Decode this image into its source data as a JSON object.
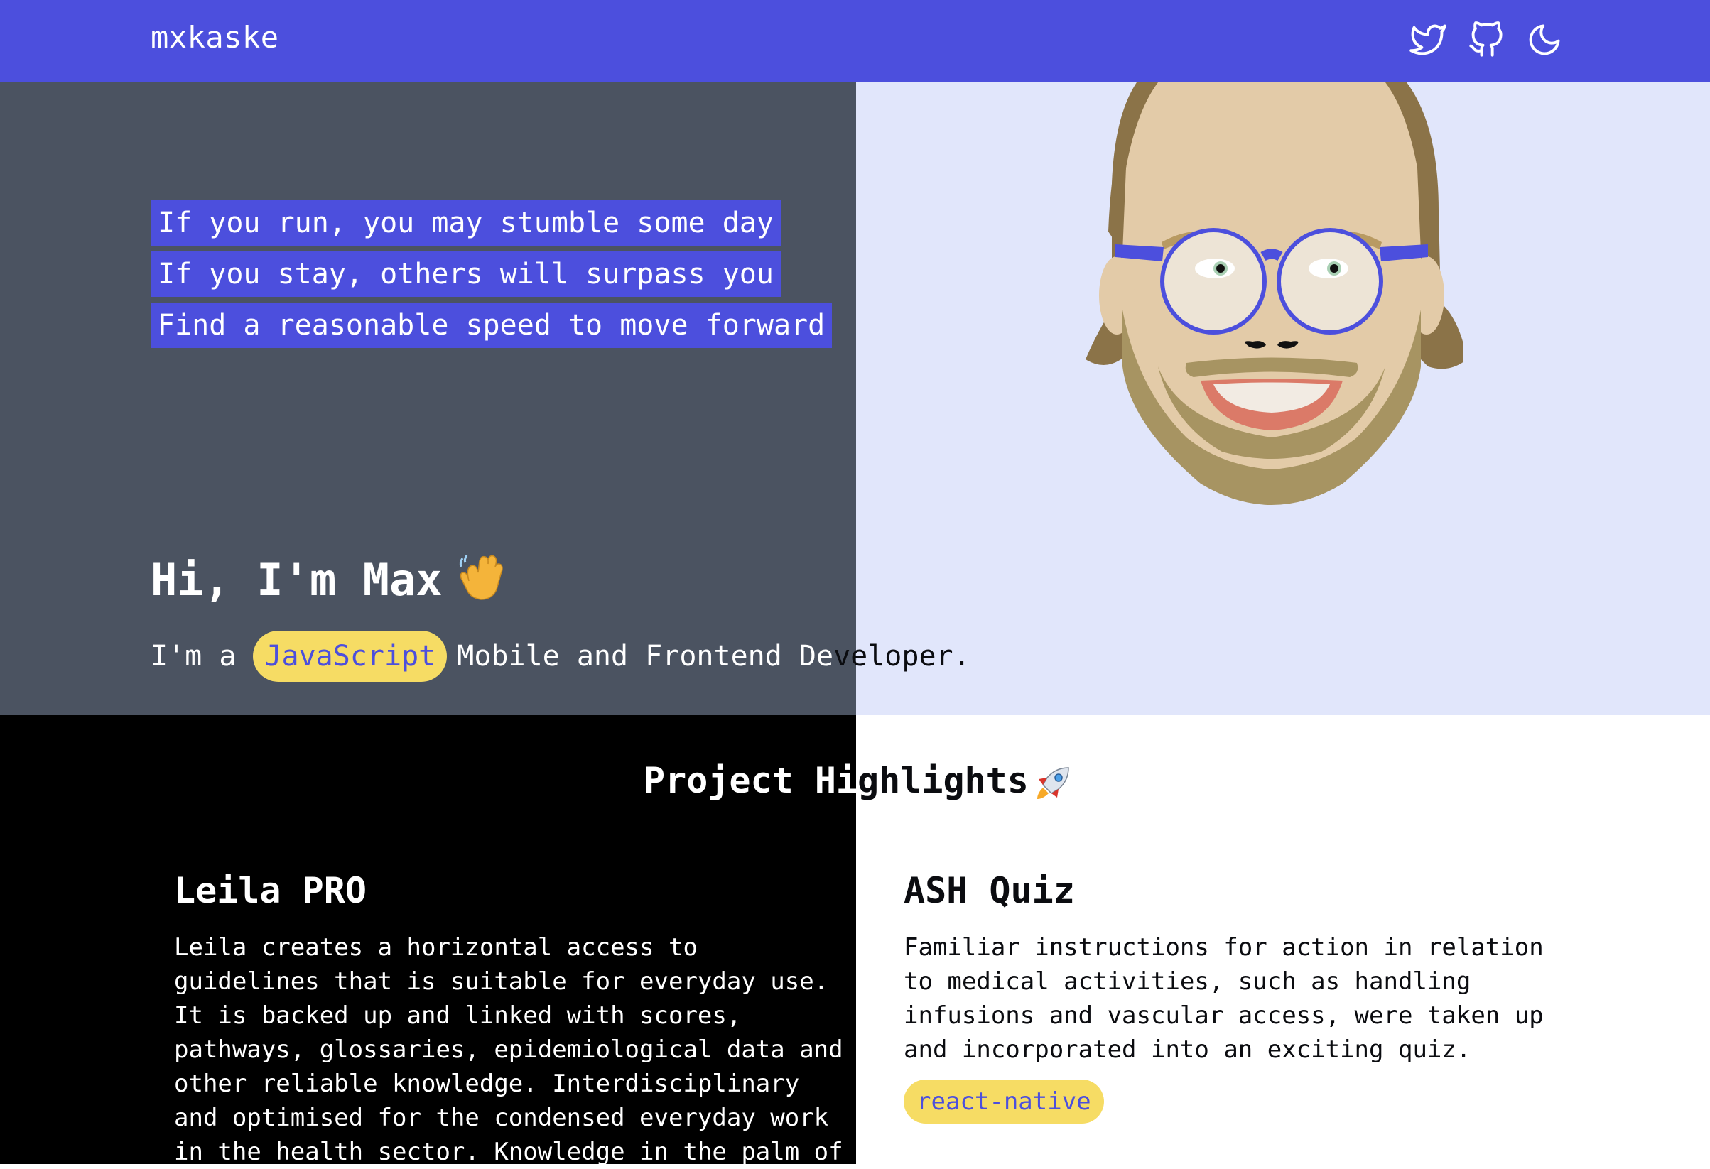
{
  "nav": {
    "brand": "mxkaske",
    "icons": [
      "twitter-icon",
      "github-icon",
      "moon-icon"
    ]
  },
  "hero": {
    "quote_lines": [
      "If you run, you may stumble some day",
      "If you stay, others will surpass you",
      "Find a reasonable speed to move forward"
    ],
    "greeting": "Hi, I'm Max",
    "intro_prefix": "I'm a",
    "intro_tag": "JavaScript",
    "intro_suffix_a": "Mobile and Frontend De",
    "intro_suffix_b": "veloper."
  },
  "projects": {
    "title_a": "Project Hi",
    "title_b": "ghlights",
    "items": [
      {
        "title": "Leila PRO",
        "desc_lines": [
          "Leila creates a horizontal access to",
          "guidelines that is suitable for everyday use.",
          "It is backed up and linked with scores,",
          "pathways, glossaries, epidemiological data and",
          "other reliable knowledge. Interdisciplinary",
          "and optimised for the condensed everyday work",
          "in the health sector. Knowledge in the palm of"
        ]
      },
      {
        "title": "ASH Quiz",
        "desc_lines": [
          "Familiar instructions for action in relation",
          "to medical activities, such as handling",
          "infusions and vascular access, were taken up",
          "and incorporated into an exciting quiz."
        ],
        "tag": "react-native"
      }
    ]
  },
  "colors": {
    "accent": "#4c4fdd",
    "hero_dark": "#4b5361",
    "hero_light": "#e1e6fb",
    "tag_yellow": "#f6dc64"
  }
}
